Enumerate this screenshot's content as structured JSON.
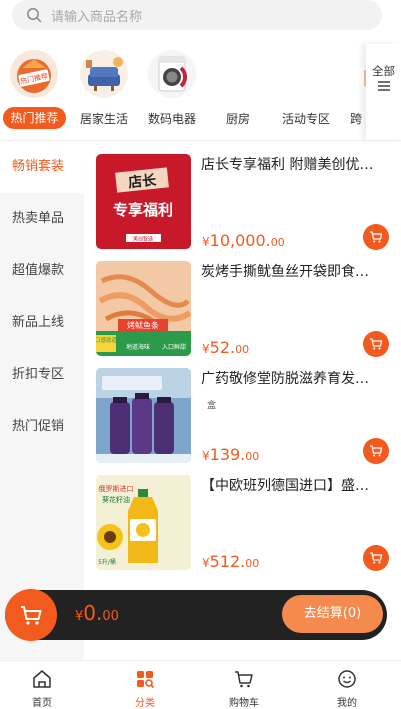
{
  "search": {
    "placeholder": "请输入商品名称",
    "icon": "search-icon"
  },
  "categories": [
    {
      "label": "热门推荐",
      "badge": "热门推荐",
      "active": true
    },
    {
      "label": "居家生活",
      "active": false
    },
    {
      "label": "数码电器",
      "active": false
    },
    {
      "label": "厨房",
      "active": false
    },
    {
      "label": "活动专区",
      "active": false
    },
    {
      "label": "跨",
      "active": false
    }
  ],
  "more": {
    "label": "全部",
    "icon": "expand-icon"
  },
  "sidebar": {
    "items": [
      {
        "label": "畅销套装",
        "active": true
      },
      {
        "label": "热卖单品",
        "active": false
      },
      {
        "label": "超值爆款",
        "active": false
      },
      {
        "label": "新品上线",
        "active": false
      },
      {
        "label": "折扣专区",
        "active": false
      },
      {
        "label": "热门促销",
        "active": false
      }
    ]
  },
  "products": [
    {
      "title": "店长专享福利 附赠美创优…",
      "subtitle": "",
      "price_symbol": "¥",
      "price_int": "10,000.",
      "price_dec": "00",
      "image_text": [
        "店长",
        "专享福利",
        "美创智选"
      ]
    },
    {
      "title": "炭烤手撕鱿鱼丝开袋即食…",
      "subtitle": "",
      "price_symbol": "¥",
      "price_int": "52.",
      "price_dec": "00",
      "image_text": [
        "烤鱿鱼条",
        "口感劲道",
        "地道海味",
        "入口鲜甜"
      ]
    },
    {
      "title": "广药敬修堂防脱滋养育发…",
      "subtitle": "盒",
      "price_symbol": "¥",
      "price_int": "139.",
      "price_dec": "00",
      "image_text": []
    },
    {
      "title": "【中欧班列德国进口】盛…",
      "subtitle": "",
      "price_symbol": "¥",
      "price_int": "512.",
      "price_dec": "00",
      "image_text": [
        "俄罗斯进口",
        "葵花籽油",
        "5升/桶"
      ]
    }
  ],
  "checkout": {
    "symbol": "¥",
    "total_int": "0.",
    "total_dec": "00",
    "button_label": "去结算(0)"
  },
  "tabbar": [
    {
      "label": "首页",
      "icon": "home-icon",
      "active": false
    },
    {
      "label": "分类",
      "icon": "category-icon",
      "active": true
    },
    {
      "label": "购物车",
      "icon": "cart-icon",
      "active": false
    },
    {
      "label": "我的",
      "icon": "profile-icon",
      "active": false
    }
  ],
  "colors": {
    "accent": "#f25a1e",
    "checkout_bg": "#222222",
    "pay_button": "#f48a4d",
    "sidebar_bg": "#f6f6f6"
  }
}
